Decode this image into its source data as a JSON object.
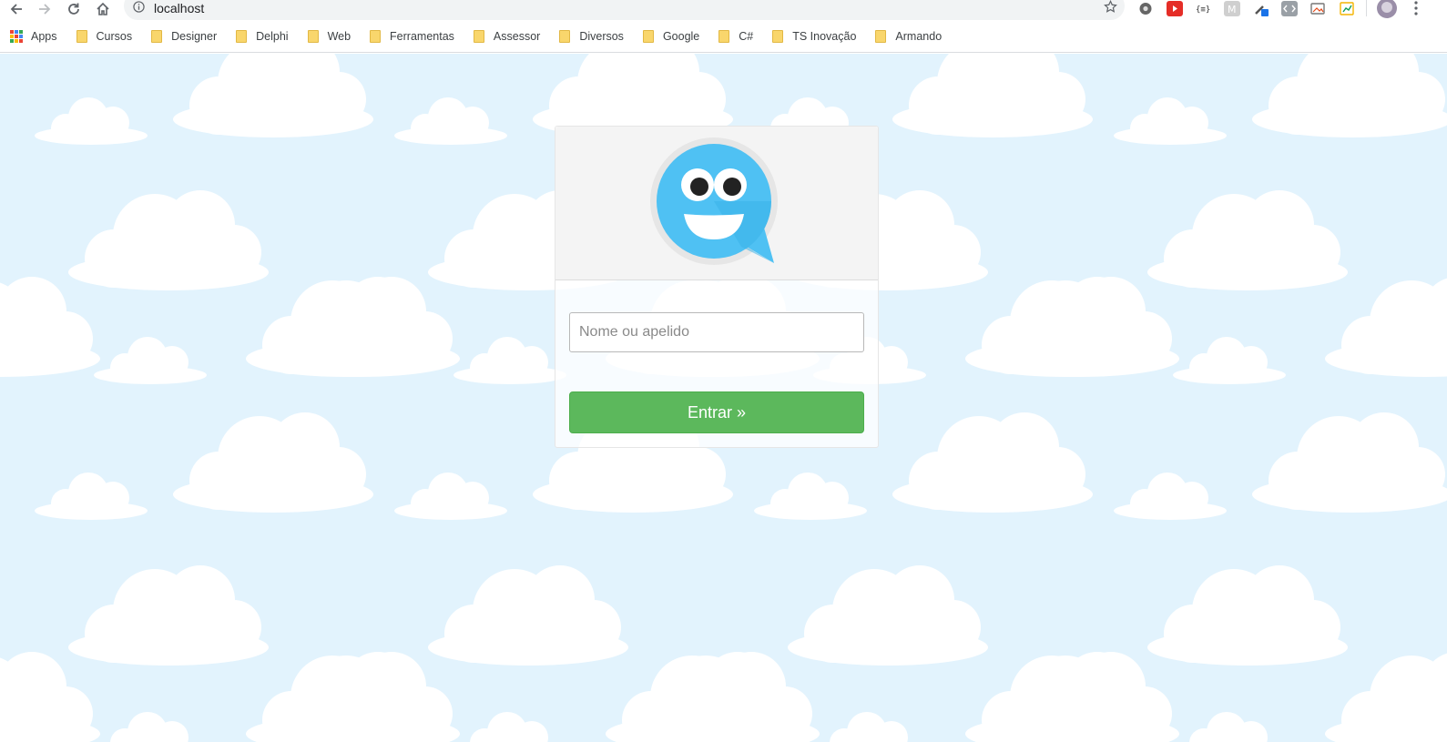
{
  "browser": {
    "url": "localhost",
    "bookmarks": [
      {
        "label": "Apps",
        "icon": "apps-icon"
      },
      {
        "label": "Cursos",
        "icon": "folder-icon"
      },
      {
        "label": "Designer",
        "icon": "folder-icon"
      },
      {
        "label": "Delphi",
        "icon": "folder-icon"
      },
      {
        "label": "Web",
        "icon": "folder-icon"
      },
      {
        "label": "Ferramentas",
        "icon": "folder-icon"
      },
      {
        "label": "Assessor",
        "icon": "folder-icon"
      },
      {
        "label": "Diversos",
        "icon": "folder-icon"
      },
      {
        "label": "Google",
        "icon": "folder-icon"
      },
      {
        "label": "C#",
        "icon": "folder-icon"
      },
      {
        "label": "TS Inovação",
        "icon": "folder-icon"
      },
      {
        "label": "Armando",
        "icon": "folder-icon"
      }
    ],
    "extension_icons": [
      "settings-extension-icon",
      "youtube-extension-icon",
      "json-extension-icon",
      "m-extension-icon",
      "eyedropper-extension-icon",
      "code-extension-icon",
      "screenshot-extension-icon",
      "chart-extension-icon"
    ]
  },
  "login": {
    "logo_icon": "smiling-chat-bubble-icon",
    "name_placeholder": "Nome ou apelido",
    "name_value": "",
    "enter_label": "Entrar »"
  },
  "colors": {
    "background": "#e2f3fd",
    "logo_blue": "#4fc1f3",
    "button_green": "#5cb85c"
  }
}
